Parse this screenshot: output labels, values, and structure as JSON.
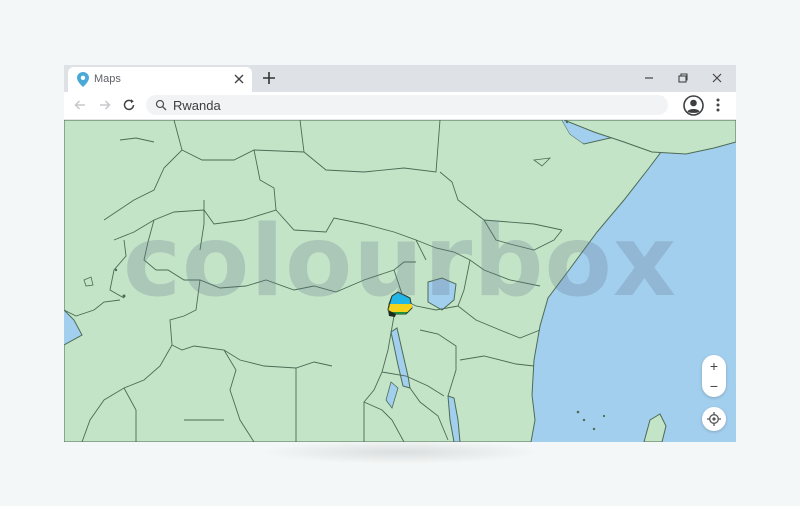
{
  "browser": {
    "tab": {
      "title": "Maps",
      "icon": "map-pin-icon",
      "pin_color": "#4aa9d6"
    },
    "address_bar": {
      "value": "Rwanda",
      "icon": "search-icon"
    },
    "window_controls": [
      "minimize-icon",
      "restore-icon",
      "close-icon"
    ],
    "nav": [
      "back-icon",
      "forward-icon",
      "reload-icon"
    ]
  },
  "map": {
    "highlighted_country": "Rwanda",
    "highlight_icon": "rwanda-flag-icon",
    "land_color": "#c4e4c8",
    "water_color": "#a3cfee",
    "border_color": "#4d6b54",
    "zoom_in_label": "+",
    "zoom_out_label": "−",
    "locate_icon": "crosshair-icon"
  },
  "watermark": {
    "text": "colourbox"
  }
}
